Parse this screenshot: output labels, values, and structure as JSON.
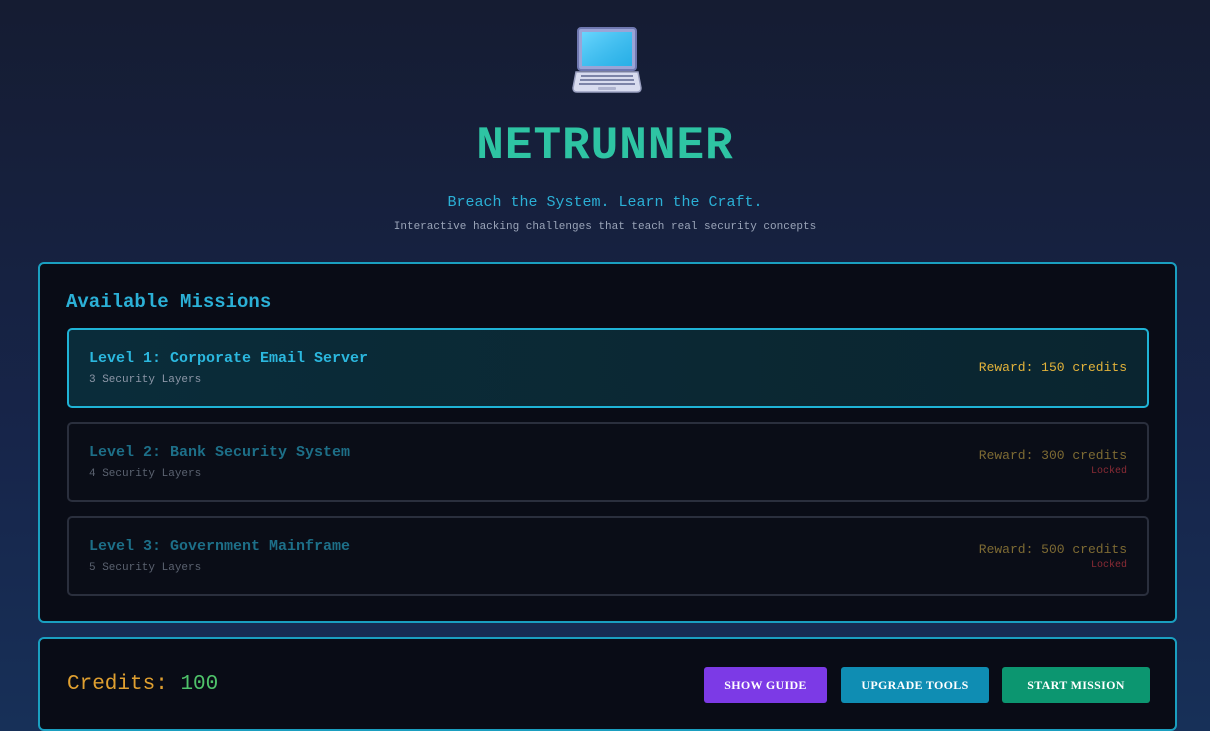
{
  "header": {
    "icon": "laptop-icon",
    "title": "NETRUNNER",
    "tagline": "Breach the System. Learn the Craft.",
    "subtagline": "Interactive hacking challenges that teach real security concepts"
  },
  "missions": {
    "heading": "Available Missions",
    "items": [
      {
        "name": "Level 1: Corporate Email Server",
        "layers": "3 Security Layers",
        "reward": "Reward: 150 credits",
        "status": ""
      },
      {
        "name": "Level 2: Bank Security System",
        "layers": "4 Security Layers",
        "reward": "Reward: 300 credits",
        "status": "Locked"
      },
      {
        "name": "Level 3: Government Mainframe",
        "layers": "5 Security Layers",
        "reward": "Reward: 500 credits",
        "status": "Locked"
      }
    ]
  },
  "footer": {
    "credits_label": "Credits:",
    "credits_value": "100",
    "show_guide_label": "SHOW GUIDE",
    "upgrade_tools_label": "UPGRADE TOOLS",
    "start_mission_label": "START MISSION"
  },
  "colors": {
    "accent": "#2bb0d6",
    "title": "#2ec4a3",
    "reward": "#e3b33a",
    "locked": "#8a2b35",
    "guide_button": "#7c3ae6",
    "upgrade_button": "#0f8db3",
    "start_button": "#0c9670"
  }
}
